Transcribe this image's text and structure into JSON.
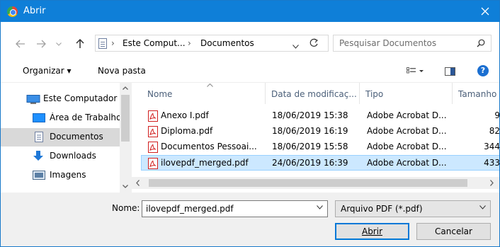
{
  "window": {
    "title": "Abrir"
  },
  "address": {
    "crumbs": [
      "Este Comput...",
      "Documentos"
    ]
  },
  "search": {
    "placeholder": "Pesquisar Documentos"
  },
  "toolbar": {
    "organize": "Organizar ▾",
    "new_folder": "Nova pasta",
    "help": "?"
  },
  "nav": {
    "items": [
      {
        "label": "Este Computador",
        "icon": "computer-icon"
      },
      {
        "label": "Área de Trabalho",
        "icon": "desktop-icon"
      },
      {
        "label": "Documentos",
        "icon": "documents-icon",
        "selected": true
      },
      {
        "label": "Downloads",
        "icon": "download-icon"
      },
      {
        "label": "Imagens",
        "icon": "images-icon"
      }
    ]
  },
  "columns": {
    "name": "Nome",
    "date": "Data de modificaç...",
    "type": "Tipo",
    "size": "Tamanho"
  },
  "files": [
    {
      "name": "Anexo I.pdf",
      "date": "18/06/2019 15:38",
      "type": "Adobe Acrobat D...",
      "size": "9"
    },
    {
      "name": "Diploma.pdf",
      "date": "18/06/2019 16:19",
      "type": "Adobe Acrobat D...",
      "size": "82"
    },
    {
      "name": "Documentos Pessoai...",
      "date": "18/06/2019 15:58",
      "type": "Adobe Acrobat D...",
      "size": "344"
    },
    {
      "name": "ilovepdf_merged.pdf",
      "date": "24/06/2019 16:39",
      "type": "Adobe Acrobat D...",
      "size": "433",
      "selected": true
    }
  ],
  "footer": {
    "name_label": "Nome:",
    "filename": "ilovepdf_merged.pdf",
    "filetype": "Arquivo PDF (*.pdf)",
    "open_label": "Abrir",
    "cancel_label": "Cancelar"
  },
  "colors": {
    "titlebar": "#0f7fd8",
    "selection": "#cce8ff",
    "pdf_red": "#d11f1f"
  }
}
